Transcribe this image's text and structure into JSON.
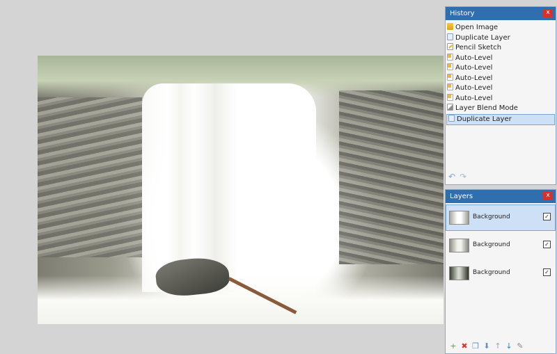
{
  "history": {
    "title": "History",
    "close_label": "x",
    "items": [
      {
        "label": "Open Image",
        "icon": "open-image-icon"
      },
      {
        "label": "Duplicate Layer",
        "icon": "duplicate-layer-icon"
      },
      {
        "label": "Pencil Sketch",
        "icon": "pencil-sketch-icon"
      },
      {
        "label": "Auto-Level",
        "icon": "adjustment-icon"
      },
      {
        "label": "Auto-Level",
        "icon": "adjustment-icon"
      },
      {
        "label": "Auto-Level",
        "icon": "adjustment-icon"
      },
      {
        "label": "Auto-Level",
        "icon": "adjustment-icon"
      },
      {
        "label": "Auto-Level",
        "icon": "adjustment-icon"
      },
      {
        "label": "Layer Blend Mode",
        "icon": "layer-properties-icon"
      },
      {
        "label": "Duplicate Layer",
        "icon": "duplicate-layer-icon"
      }
    ],
    "selected_index": 9,
    "undo_glyph": "↶",
    "redo_glyph": "↷"
  },
  "layers": {
    "title": "Layers",
    "close_label": "x",
    "items": [
      {
        "name": "Background",
        "visible": true,
        "selected": true
      },
      {
        "name": "Background",
        "visible": true,
        "selected": false
      },
      {
        "name": "Background",
        "visible": true,
        "selected": false
      }
    ],
    "check_glyph": "✓",
    "toolbar": {
      "add": "+",
      "delete": "✖",
      "duplicate": "❐",
      "merge": "⬇",
      "move_up": "↑",
      "move_down": "↓",
      "properties": "✎"
    }
  },
  "colors": {
    "title_bar": "#2f6fb0",
    "close_button": "#d9302b",
    "selection": "#cde0f5",
    "workspace": "#d4d4d4"
  }
}
